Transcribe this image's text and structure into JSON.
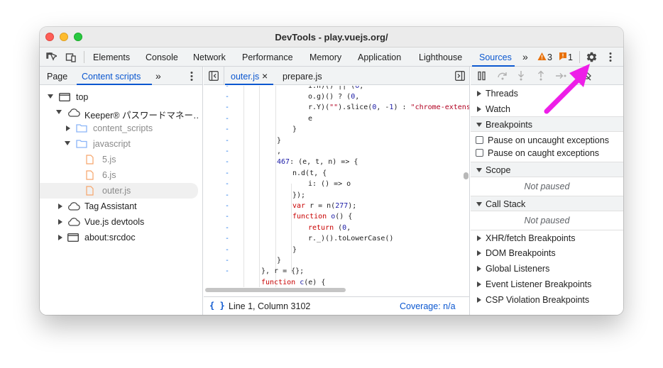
{
  "window": {
    "title": "DevTools - play.vuejs.org/"
  },
  "main_tabs": {
    "items": [
      "Elements",
      "Console",
      "Network",
      "Performance",
      "Memory",
      "Application",
      "Lighthouse",
      "Sources"
    ],
    "more": "»",
    "warning_count": "3",
    "issue_count": "1"
  },
  "left_panel": {
    "tabs": [
      "Page",
      "Content scripts"
    ],
    "more": "»",
    "tree": [
      {
        "label": "top",
        "icon": "frame-icon",
        "expanded": true
      },
      {
        "label": "Keeper® パスワードマネー…",
        "icon": "cloud-icon",
        "expanded": true
      },
      {
        "label": "content_scripts",
        "icon": "folder-icon",
        "expanded": false
      },
      {
        "label": "javascript",
        "icon": "folder-icon",
        "expanded": true
      },
      {
        "label": "5.js",
        "icon": "file-icon"
      },
      {
        "label": "6.js",
        "icon": "file-icon"
      },
      {
        "label": "outer.js",
        "icon": "file-icon",
        "selected": true
      },
      {
        "label": "Tag Assistant",
        "icon": "cloud-icon",
        "expanded": false
      },
      {
        "label": "Vue.js devtools",
        "icon": "cloud-icon",
        "expanded": false
      },
      {
        "label": "about:srcdoc",
        "icon": "frame-icon",
        "expanded": false
      }
    ]
  },
  "editor": {
    "tabs": [
      {
        "label": "outer.js",
        "close": "×",
        "active": true
      },
      {
        "label": "prepare.js"
      }
    ],
    "lines": [
      "i.n)() || (0,",
      "o.g)() ? (0,",
      "r.Y)(\"\").slice(0, -1) : \"chrome-extensi",
      "e",
      "}",
      "}",
      ",",
      "467: (e, t, n) => {",
      "n.d(t, {",
      "i: () => o",
      "});",
      "var r = n(277);",
      "function o() {",
      "return (0,",
      "r._)().toLowerCase()",
      "}",
      "}",
      "}, r = {};",
      "function c(e) {"
    ],
    "status": {
      "position": "Line 1, Column 3102",
      "coverage": "Coverage: n/a",
      "format_icon": "{ }"
    }
  },
  "right_panel": {
    "sections": {
      "threads": "Threads",
      "watch": "Watch",
      "breakpoints": "Breakpoints",
      "pause_uncaught": "Pause on uncaught exceptions",
      "pause_caught": "Pause on caught exceptions",
      "scope": "Scope",
      "scope_status": "Not paused",
      "call_stack": "Call Stack",
      "call_stack_status": "Not paused",
      "xhr": "XHR/fetch Breakpoints",
      "dom": "DOM Breakpoints",
      "global": "Global Listeners",
      "event": "Event Listener Breakpoints",
      "csp": "CSP Violation Breakpoints"
    }
  },
  "colors": {
    "accent": "#0b57d0",
    "annotation_arrow": "#ee1ee8",
    "warning": "#e8710a",
    "issue": "#d93025"
  }
}
